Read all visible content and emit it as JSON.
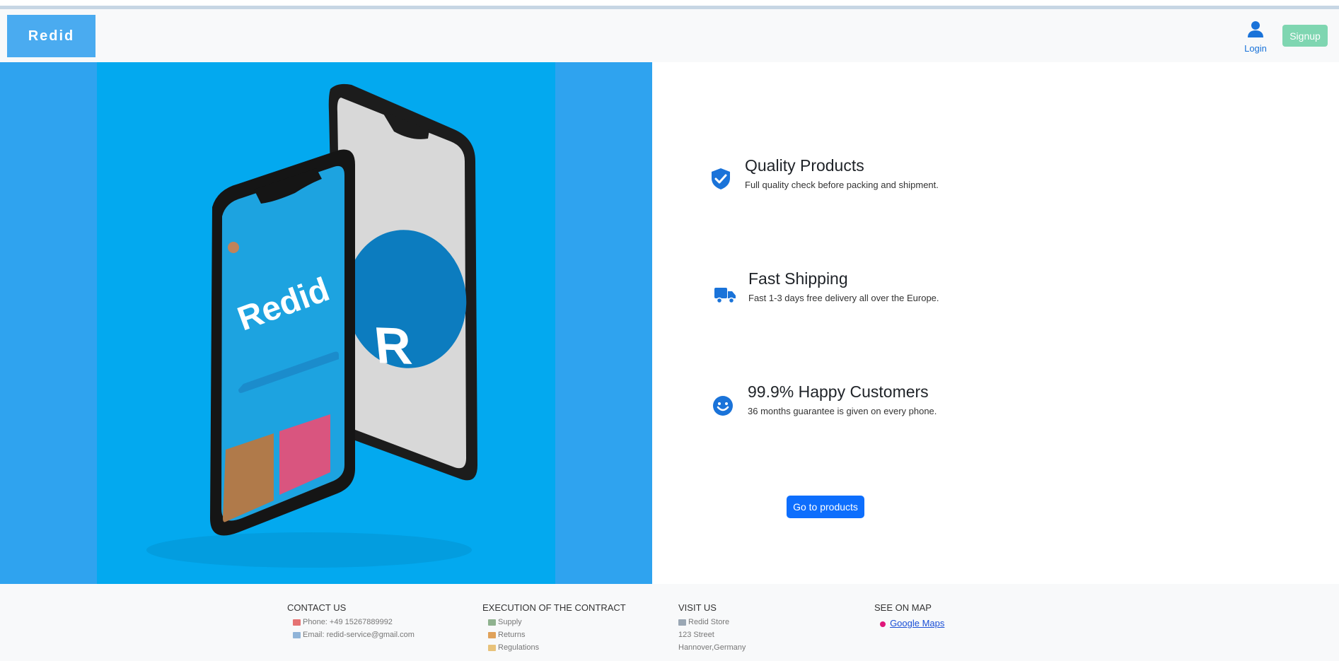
{
  "brand": {
    "name": "Redid"
  },
  "nav": {
    "login_label": "Login",
    "signup_label": "Signup"
  },
  "hero": {
    "phone_brand": "Redid",
    "phone_logo_letter": "R"
  },
  "features": [
    {
      "title": "Quality Products",
      "desc": "Full quality check before packing and shipment.",
      "icon": "shield-check-icon"
    },
    {
      "title": "Fast Shipping",
      "desc": "Fast 1-3 days free delivery all over the Europe.",
      "icon": "truck-icon"
    },
    {
      "title": "99.9% Happy Customers",
      "desc": "36 months guarantee is given on every phone.",
      "icon": "smile-icon"
    }
  ],
  "cta": {
    "label": "Go to products"
  },
  "footer": {
    "contact": {
      "heading": "CONTACT US",
      "phone": "Phone: +49 15267889992",
      "email": "Email: redid-service@gmail.com"
    },
    "contract": {
      "heading": "EXECUTION OF THE CONTRACT",
      "items": [
        "Supply",
        "Returns",
        "Regulations"
      ]
    },
    "visit": {
      "heading": "VISIT US",
      "lines": [
        "Redid Store",
        "123 Street",
        "Hannover,Germany"
      ]
    },
    "map": {
      "heading": "SEE ON MAP",
      "link": "Google Maps"
    }
  },
  "colors": {
    "accent": "#1a73d9",
    "hero_bg": "#2fa3ef",
    "hero_inner": "#03a9ef",
    "cta": "#0d6efd",
    "signup": "#7fd6b1"
  }
}
